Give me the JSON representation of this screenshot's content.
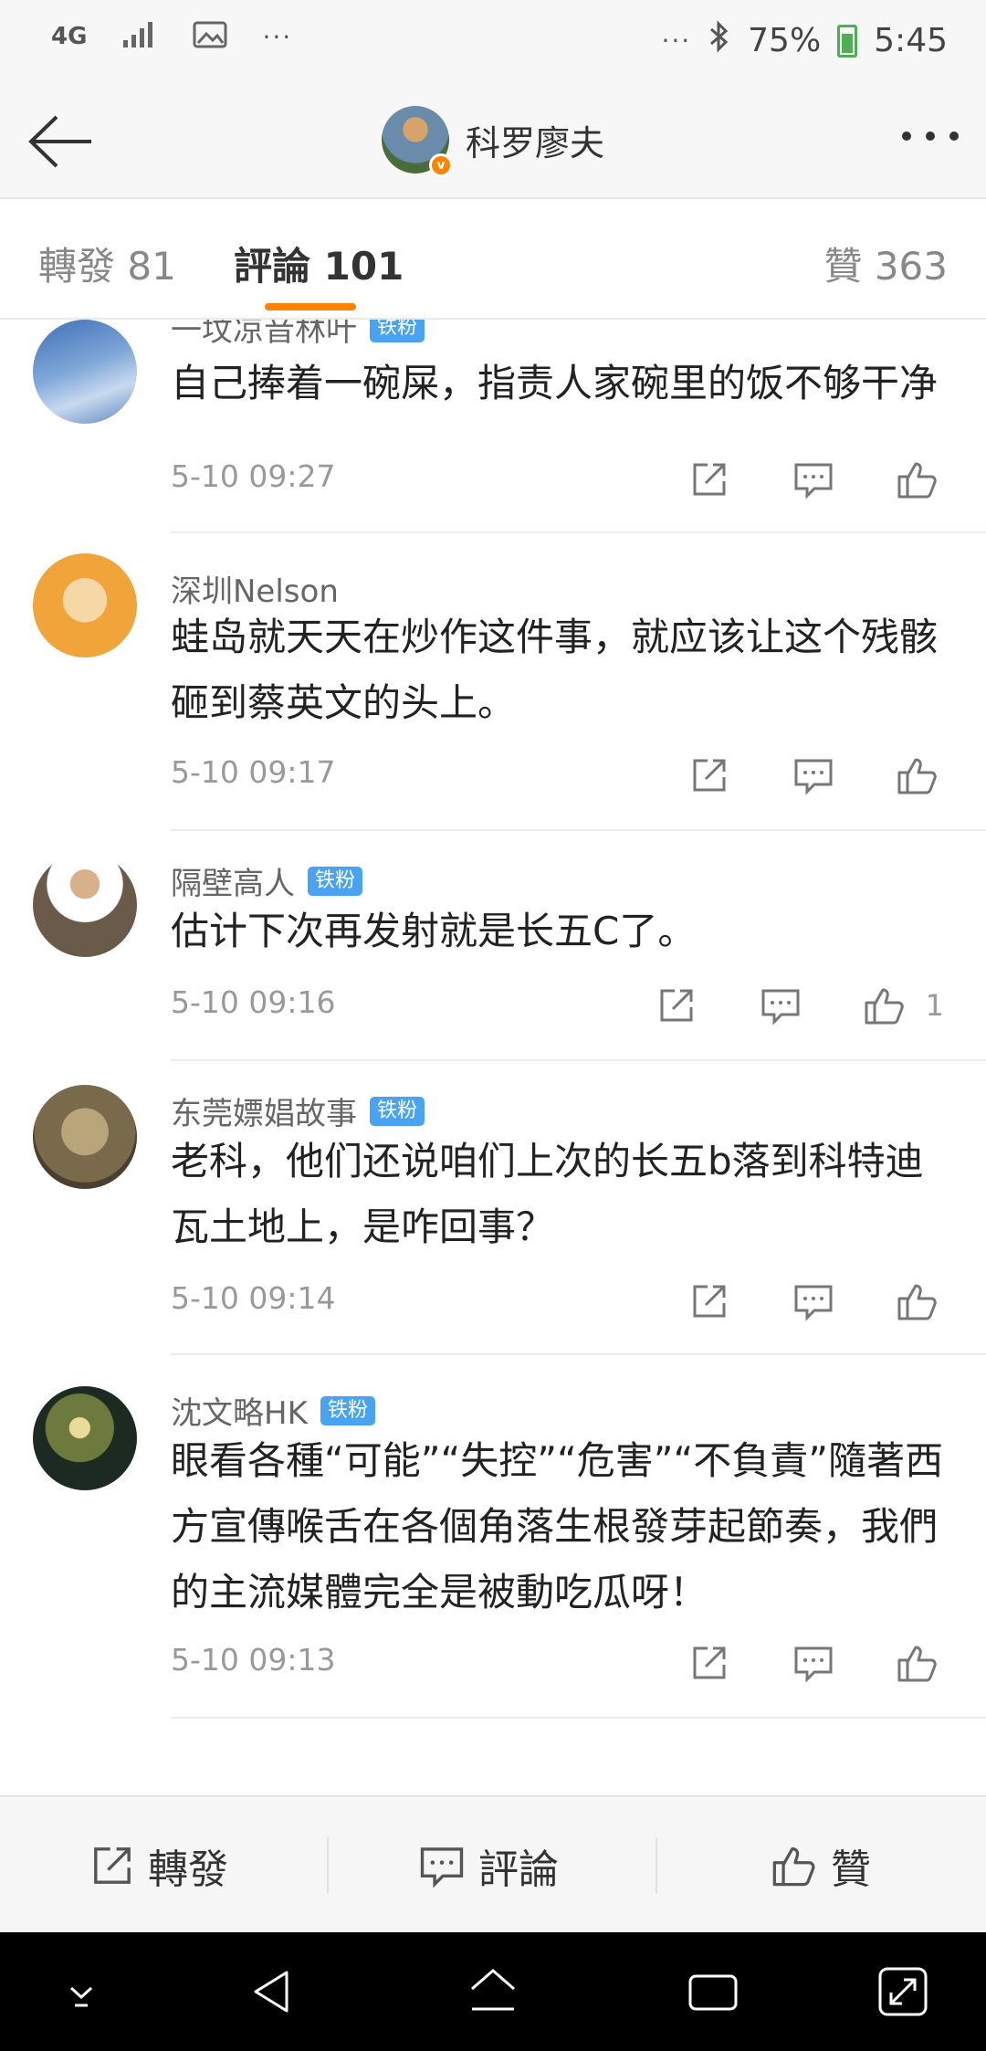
{
  "status_bar": {
    "network": "4G",
    "dots_left": "···",
    "dots_right": "···",
    "battery_percent": "75%",
    "time": "5:45"
  },
  "nav": {
    "title": "科罗廖夫",
    "verified_mark": "v"
  },
  "tabs": [
    {
      "label": "轉發 81"
    },
    {
      "label": "評論 101"
    },
    {
      "label": "贊 363"
    }
  ],
  "comments": [
    {
      "name": "一坟凉音林叶",
      "badge": "铁粉",
      "text": "自己捧着一碗屎，指责人家碗里的饭不够干净",
      "time": "5-10 09:27",
      "likes": ""
    },
    {
      "name": "深圳Nelson",
      "badge": "",
      "text": "蛙岛就天天在炒作这件事，就应该让这个残骸砸到蔡英文的头上。",
      "time": "5-10 09:17",
      "likes": ""
    },
    {
      "name": "隔壁高人",
      "badge": "铁粉",
      "text": "估计下次再发射就是长五C了。",
      "time": "5-10 09:16",
      "likes": "1"
    },
    {
      "name": "东莞嫖娼故事",
      "badge": "铁粉",
      "text": "老科，他们还说咱们上次的长五b落到科特迪瓦土地上，是咋回事？",
      "time": "5-10 09:14",
      "likes": ""
    },
    {
      "name": "沈文略HK",
      "badge": "铁粉",
      "text": "眼看各種“可能”“失控”“危害”“不負責”隨著西方宣傳喉舌在各個角落生根發芽起節奏，我們的主流媒體完全是被動吃瓜呀！",
      "time": "5-10 09:13",
      "likes": ""
    }
  ],
  "bottom_bar": {
    "repost": "轉發",
    "comment": "評論",
    "like": "贊"
  },
  "colors": {
    "accent": "#ff8200",
    "badge": "#4aa3f0",
    "text": "#222222",
    "meta": "#999999"
  }
}
